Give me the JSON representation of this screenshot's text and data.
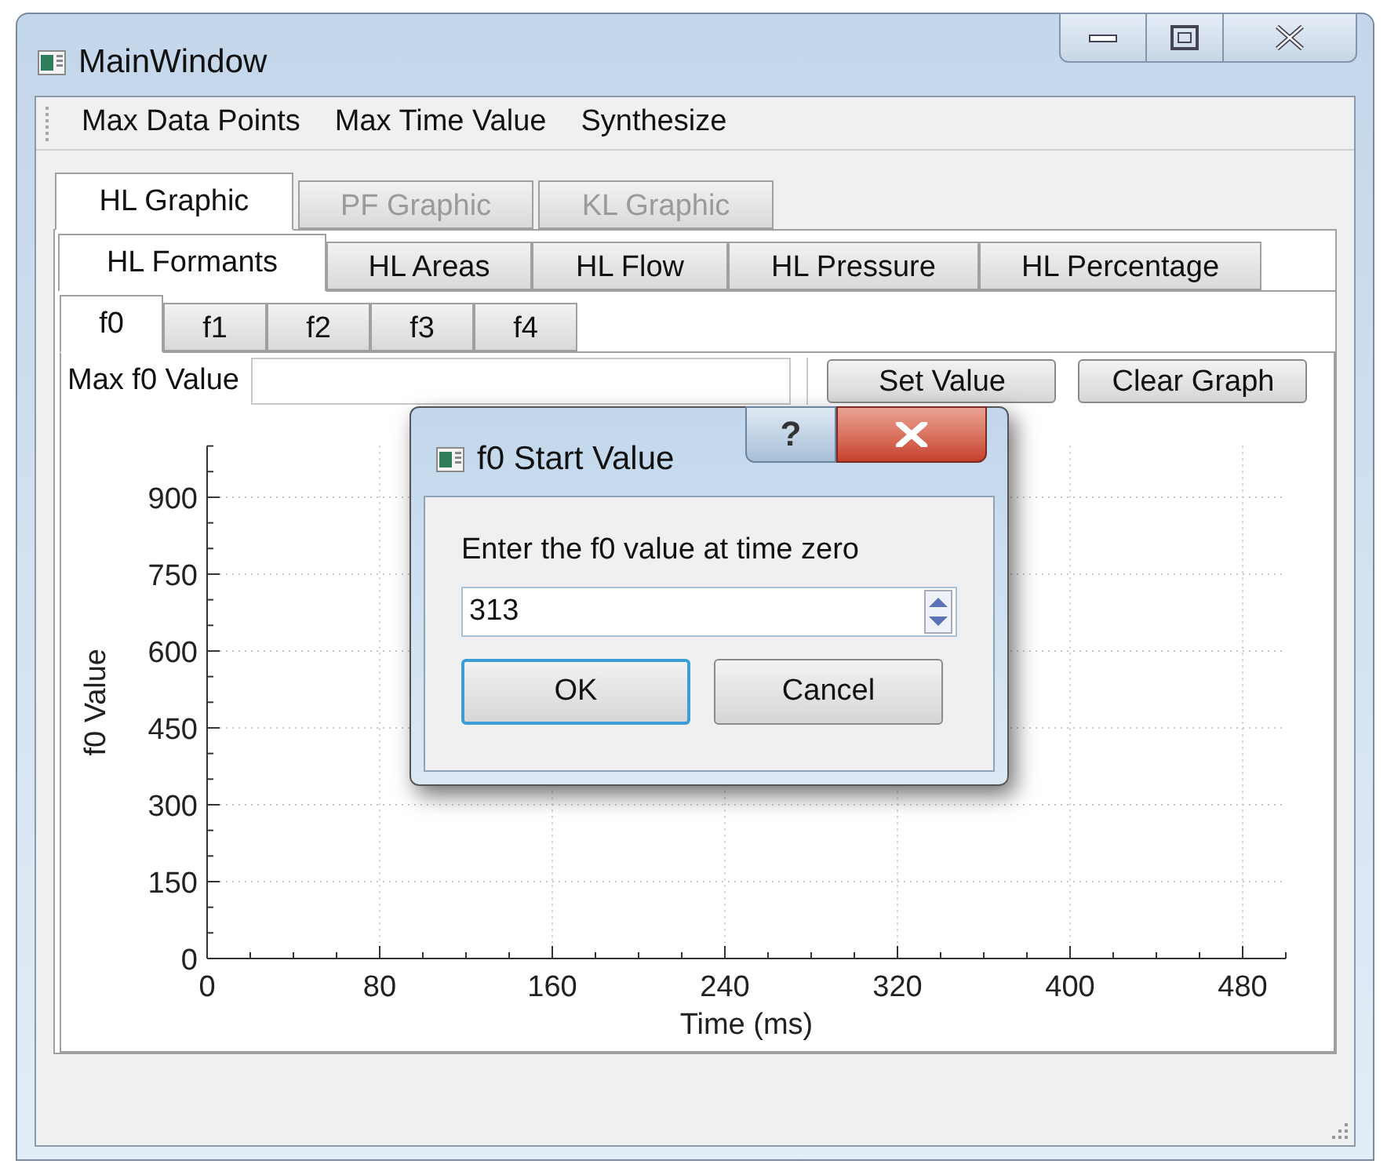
{
  "window": {
    "title": "MainWindow"
  },
  "menu": [
    "Max Data Points",
    "Max Time Value",
    "Synthesize"
  ],
  "graphic_tabs": [
    {
      "label": "HL Graphic",
      "selected": true,
      "disabled": false
    },
    {
      "label": "PF Graphic",
      "selected": false,
      "disabled": true
    },
    {
      "label": "KL Graphic",
      "selected": false,
      "disabled": true
    }
  ],
  "hl_tabs": [
    {
      "label": "HL Formants",
      "selected": true
    },
    {
      "label": "HL Areas",
      "selected": false
    },
    {
      "label": "HL Flow",
      "selected": false
    },
    {
      "label": "HL Pressure",
      "selected": false
    },
    {
      "label": "HL Percentage",
      "selected": false
    }
  ],
  "formant_tabs": [
    {
      "label": "f0",
      "selected": true
    },
    {
      "label": "f1",
      "selected": false
    },
    {
      "label": "f2",
      "selected": false
    },
    {
      "label": "f3",
      "selected": false
    },
    {
      "label": "f4",
      "selected": false
    }
  ],
  "max_field": {
    "label": "Max f0 Value"
  },
  "buttons": [
    "Set Value",
    "Clear Graph"
  ],
  "chart_data": {
    "type": "line",
    "xlabel": "Time (ms)",
    "ylabel": "f0 Value",
    "xlim": [
      0,
      500
    ],
    "ylim": [
      0,
      1000
    ],
    "xticks": [
      0,
      80,
      160,
      240,
      320,
      400,
      480
    ],
    "yticks": [
      0,
      150,
      300,
      450,
      600,
      750,
      900
    ],
    "grid": true
  },
  "dialog": {
    "title": "f0 Start Value",
    "help": "?",
    "prompt": "Enter the f0 value at time zero",
    "value": "313",
    "buttons": [
      "OK",
      "Cancel"
    ]
  }
}
